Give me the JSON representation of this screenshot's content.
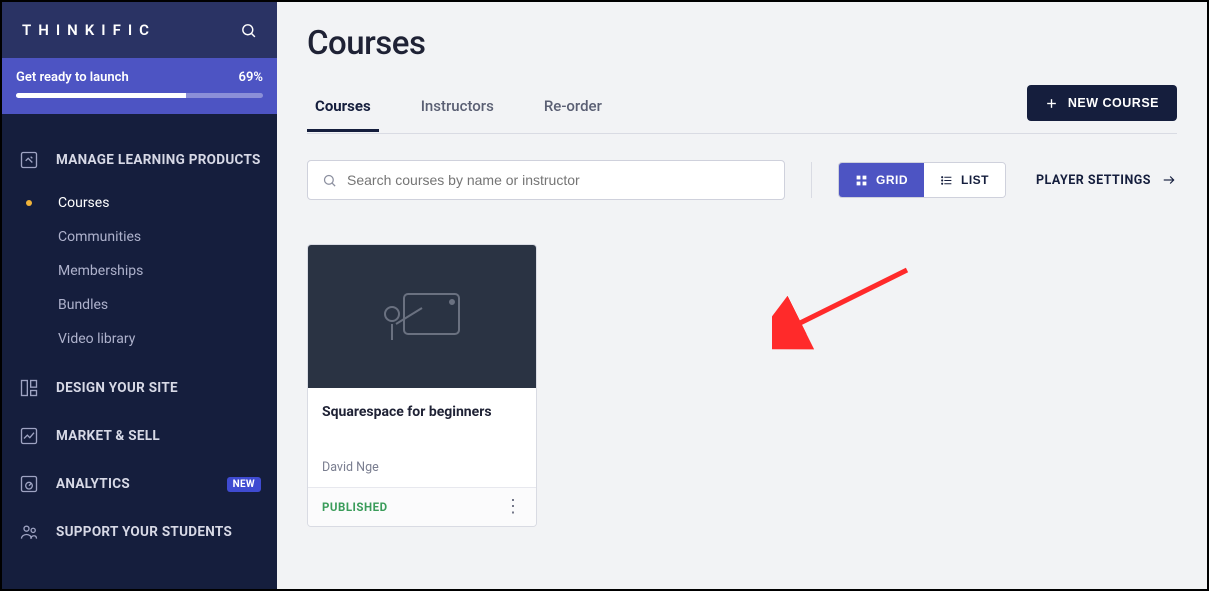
{
  "brand": "THINKIFIC",
  "progress": {
    "label": "Get ready to launch",
    "pct_text": "69%",
    "pct": 69
  },
  "sidebar": {
    "sections": [
      {
        "label": "MANAGE LEARNING PRODUCTS",
        "icon": "edit-square-icon",
        "badge": null
      },
      {
        "label": "DESIGN YOUR SITE",
        "icon": "layout-icon",
        "badge": null
      },
      {
        "label": "MARKET & SELL",
        "icon": "chart-up-icon",
        "badge": null
      },
      {
        "label": "ANALYTICS",
        "icon": "gauge-icon",
        "badge": "NEW"
      },
      {
        "label": "SUPPORT YOUR STUDENTS",
        "icon": "people-icon",
        "badge": null
      }
    ],
    "learning_items": [
      {
        "label": "Courses",
        "active": true
      },
      {
        "label": "Communities",
        "active": false
      },
      {
        "label": "Memberships",
        "active": false
      },
      {
        "label": "Bundles",
        "active": false
      },
      {
        "label": "Video library",
        "active": false
      }
    ]
  },
  "page": {
    "title": "Courses",
    "tabs": [
      {
        "label": "Courses",
        "active": true
      },
      {
        "label": "Instructors",
        "active": false
      },
      {
        "label": "Re-order",
        "active": false
      }
    ],
    "new_course_btn": "NEW COURSE",
    "search_placeholder": "Search courses by name or instructor",
    "view_toggle": {
      "grid": "GRID",
      "list": "LIST"
    },
    "player_settings": "PLAYER SETTINGS"
  },
  "courses": [
    {
      "title": "Squarespace for beginners",
      "author": "David Nge",
      "status": "PUBLISHED"
    }
  ]
}
